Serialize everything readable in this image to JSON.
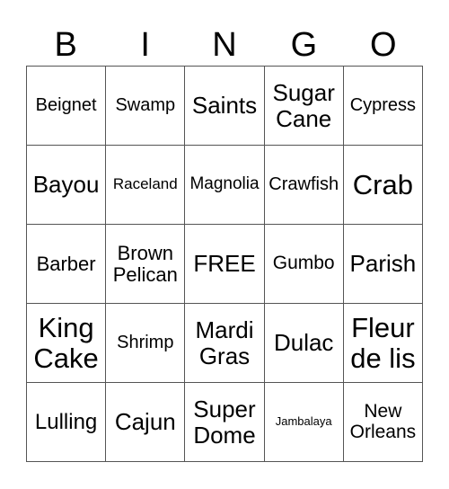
{
  "header": [
    "B",
    "I",
    "N",
    "G",
    "O"
  ],
  "cells": [
    [
      "Beignet",
      "Swamp",
      "Saints",
      "Sugar Cane",
      "Cypress"
    ],
    [
      "Bayou",
      "Raceland",
      "Magnolia",
      "Crawfish",
      "Crab"
    ],
    [
      "Barber",
      "Brown Pelican",
      "FREE",
      "Gumbo",
      "Parish"
    ],
    [
      "King Cake",
      "Shrimp",
      "Mardi Gras",
      "Dulac",
      "Fleur de lis"
    ],
    [
      "Lulling",
      "Cajun",
      "Super Dome",
      "Jambalaya",
      "New Orleans"
    ]
  ]
}
